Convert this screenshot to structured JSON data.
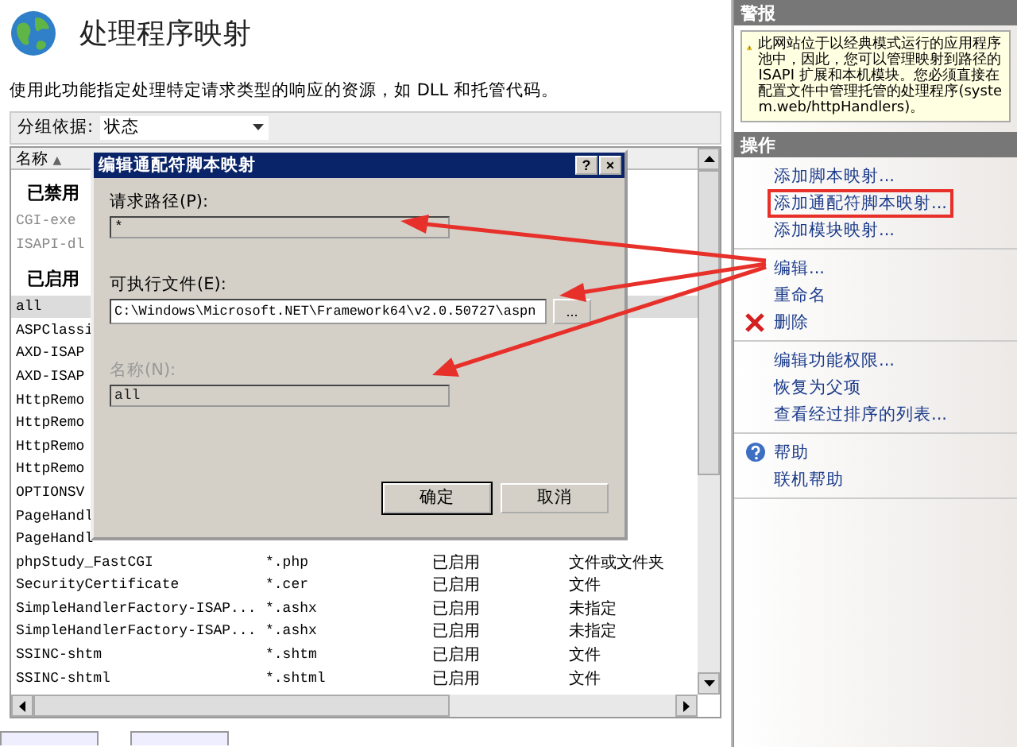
{
  "header": {
    "title": "处理程序映射",
    "description": "使用此功能指定处理特定请求类型的响应的资源，如 DLL 和托管代码。"
  },
  "group_by": {
    "label": "分组依据:",
    "value": "状态"
  },
  "list": {
    "columns": [
      {
        "label": "名称",
        "sort_arrow": "▲"
      }
    ],
    "groups": [
      {
        "label": "已禁用",
        "disabled": true,
        "rows": [
          {
            "name": "CGI-exe",
            "selected": false
          },
          {
            "name": "ISAPI-dl",
            "selected": false
          }
        ]
      },
      {
        "label": "已启用",
        "disabled": false,
        "rows": [
          {
            "name": "all",
            "selected": true
          },
          {
            "name": "ASPClassi",
            "selected": false
          },
          {
            "name": "AXD-ISAP",
            "selected": false
          },
          {
            "name": "AXD-ISAP",
            "selected": false
          },
          {
            "name": "HttpRemo",
            "selected": false
          },
          {
            "name": "HttpRemo",
            "selected": false
          },
          {
            "name": "HttpRemo",
            "selected": false
          },
          {
            "name": "HttpRemo",
            "selected": false
          },
          {
            "name": "OPTIONSV",
            "selected": false
          },
          {
            "name": "PageHandl",
            "selected": false
          },
          {
            "name": "PageHandl",
            "selected": false
          },
          {
            "name": "phpStudy_FastCGI",
            "path": "*.php",
            "state": "已启用",
            "path_type": "文件或文件夹",
            "selected": false
          },
          {
            "name": "SecurityCertificate",
            "path": "*.cer",
            "state": "已启用",
            "path_type": "文件",
            "selected": false
          },
          {
            "name": "SimpleHandlerFactory-ISAP...",
            "path": "*.ashx",
            "state": "已启用",
            "path_type": "未指定",
            "selected": false
          },
          {
            "name": "SimpleHandlerFactory-ISAP...",
            "path": "*.ashx",
            "state": "已启用",
            "path_type": "未指定",
            "selected": false
          },
          {
            "name": "SSINC-shtm",
            "path": "*.shtm",
            "state": "已启用",
            "path_type": "文件",
            "selected": false
          },
          {
            "name": "SSINC-shtml",
            "path": "*.shtml",
            "state": "已启用",
            "path_type": "文件",
            "selected": false
          }
        ]
      }
    ]
  },
  "dialog": {
    "title": "编辑通配符脚本映射",
    "help_button": "?",
    "close_button": "×",
    "fields": [
      {
        "label": "请求路径(P):",
        "value": "*",
        "disabled": false
      },
      {
        "label": "可执行文件(E):",
        "value": "C:\\Windows\\Microsoft.NET\\Framework64\\v2.0.50727\\aspn",
        "disabled": false,
        "browse_label": "..."
      },
      {
        "label": "名称(N):",
        "value": "all",
        "disabled": true
      }
    ],
    "buttons": [
      {
        "label": "确定",
        "default": true
      },
      {
        "label": "取消",
        "default": false
      }
    ]
  },
  "alerts": {
    "title": "警报",
    "message": "此网站位于以经典模式运行的应用程序池中，因此，您可以管理映射到路径的 ISAPI 扩展和本机模块。您必须直接在配置文件中管理托管的处理程序(system.web/httpHandlers)。"
  },
  "actions": {
    "title": "操作",
    "groups": [
      [
        {
          "label": "添加脚本映射...",
          "kind": "plain",
          "highlighted": false
        },
        {
          "label": "添加通配符脚本映射...",
          "kind": "plain",
          "highlighted": true
        },
        {
          "label": "添加模块映射...",
          "kind": "plain",
          "highlighted": false
        }
      ],
      [
        {
          "label": "编辑...",
          "kind": "plain",
          "highlighted": false
        },
        {
          "label": "重命名",
          "kind": "plain",
          "highlighted": false
        },
        {
          "label": "删除",
          "kind": "delete",
          "highlighted": false
        }
      ],
      [
        {
          "label": "编辑功能权限...",
          "kind": "plain",
          "highlighted": false
        },
        {
          "label": "恢复为父项",
          "kind": "plain",
          "highlighted": false
        },
        {
          "label": "查看经过排序的列表...",
          "kind": "plain",
          "highlighted": false
        }
      ],
      [
        {
          "label": "帮助",
          "kind": "help",
          "highlighted": false
        },
        {
          "label": "联机帮助",
          "kind": "plain",
          "highlighted": false
        }
      ]
    ]
  }
}
